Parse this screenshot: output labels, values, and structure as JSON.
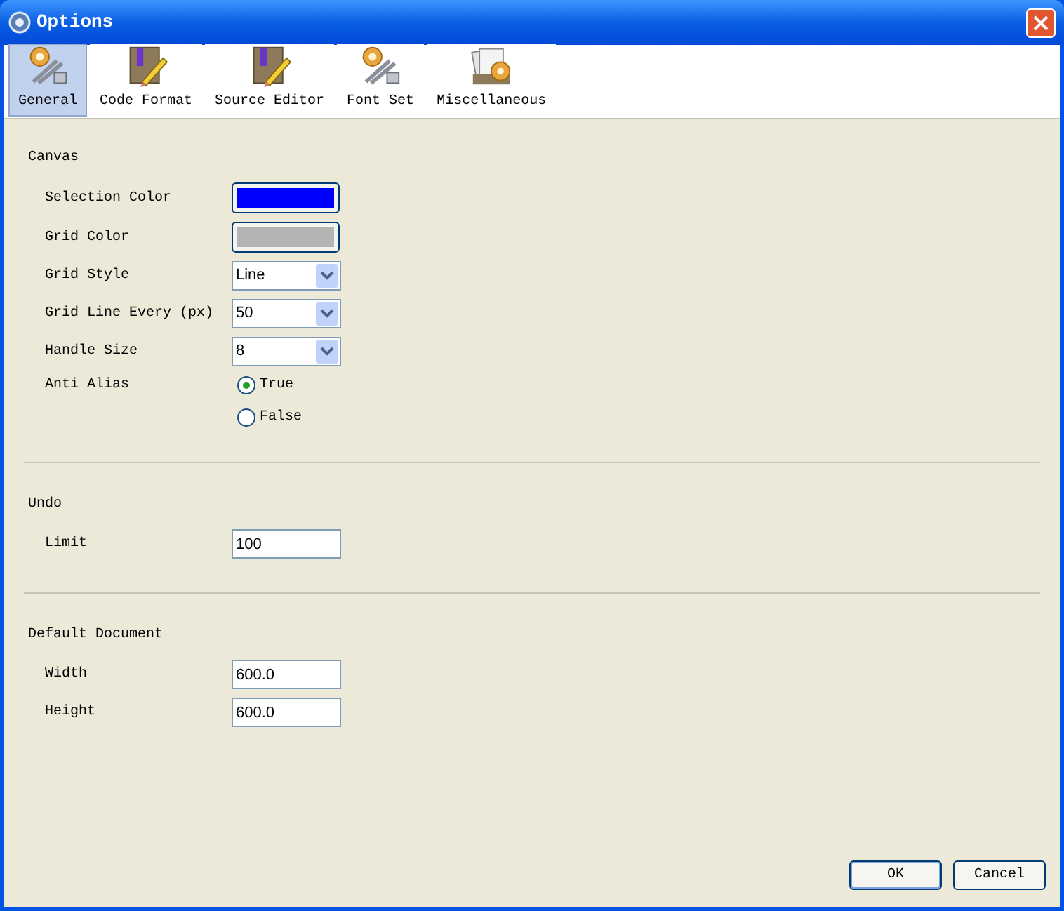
{
  "window": {
    "title": "Options"
  },
  "tabs": [
    {
      "label": "General",
      "kind": "tools",
      "selected": true
    },
    {
      "label": "Code Format",
      "kind": "book",
      "selected": false
    },
    {
      "label": "Source Editor",
      "kind": "book",
      "selected": false
    },
    {
      "label": "Font Set",
      "kind": "tools",
      "selected": false
    },
    {
      "label": "Miscellaneous",
      "kind": "papers",
      "selected": false
    }
  ],
  "sections": [
    {
      "title": "Canvas",
      "fields": [
        {
          "label": "Selection Color",
          "kind": "color",
          "color": "#0000ff"
        },
        {
          "label": "Grid Color",
          "kind": "color",
          "color": "#b4b4b4"
        },
        {
          "label": "Grid Style",
          "kind": "select",
          "value": "Line"
        },
        {
          "label": "Grid Line Every (px)",
          "kind": "select",
          "value": "50"
        },
        {
          "label": "Handle Size",
          "kind": "select",
          "value": "8"
        },
        {
          "label": "Anti Alias",
          "kind": "radio",
          "options": [
            {
              "label": "True",
              "selected": true
            },
            {
              "label": "False",
              "selected": false
            }
          ]
        }
      ]
    },
    {
      "title": "Undo",
      "fields": [
        {
          "label": "Limit",
          "kind": "text",
          "value": "100"
        }
      ]
    },
    {
      "title": "Default Document",
      "fields": [
        {
          "label": "Width",
          "kind": "text",
          "value": "600.0"
        },
        {
          "label": "Height",
          "kind": "text",
          "value": "600.0"
        }
      ]
    }
  ],
  "buttons": [
    {
      "label": "OK",
      "default": true
    },
    {
      "label": "Cancel",
      "default": false
    }
  ]
}
